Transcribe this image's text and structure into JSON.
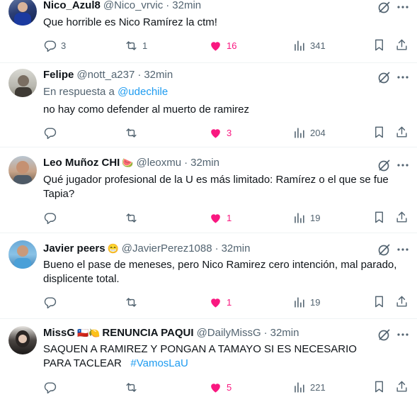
{
  "tweets": [
    {
      "name": "Nico_Azul8",
      "name_emoji": "",
      "handle": "@Nico_vrvic",
      "time": "32min",
      "reply_prefix": "",
      "reply_to": "",
      "text": "Que horrible es Nico Ramírez la ctm!",
      "hashtag": "",
      "replies": "3",
      "retweets": "1",
      "likes": "16",
      "views": "341",
      "liked": true
    },
    {
      "name": "Felipe",
      "name_emoji": "",
      "handle": "@nott_a237",
      "time": "32min",
      "reply_prefix": "En respuesta a",
      "reply_to": "@udechile",
      "text": "no hay como defender al muerto de ramirez",
      "hashtag": "",
      "replies": "",
      "retweets": "",
      "likes": "3",
      "views": "204",
      "liked": true
    },
    {
      "name": "Leo Muñoz CHI",
      "name_emoji": "🍉",
      "handle": "@leoxmu",
      "time": "32min",
      "reply_prefix": "",
      "reply_to": "",
      "text": "Qué jugador profesional de la U es más limitado: Ramírez o el que se fue Tapia?",
      "hashtag": "",
      "replies": "",
      "retweets": "",
      "likes": "1",
      "views": "19",
      "liked": true
    },
    {
      "name": "Javier peers",
      "name_emoji": "😁",
      "handle": "@JavierPerez1088",
      "time": "32min",
      "reply_prefix": "",
      "reply_to": "",
      "text": "Bueno el pase de meneses, pero Nico Ramirez cero intención, mal parado, displicente total.",
      "hashtag": "",
      "replies": "",
      "retweets": "",
      "likes": "1",
      "views": "19",
      "liked": true
    },
    {
      "name": "MissG",
      "name_emoji": "🇨🇱🍋",
      "name_suffix": "RENUNCIA PAQUI",
      "handle": "@DailyMissG",
      "time": "32min",
      "reply_prefix": "",
      "reply_to": "",
      "text": "SAQUEN A RAMIREZ Y PONGAN A TAMAYO SI ES NECESARIO PARA TACLEAR",
      "hashtag": "#VamosLaU",
      "replies": "",
      "retweets": "",
      "likes": "5",
      "views": "221",
      "liked": true
    }
  ],
  "colors": {
    "like": "#f91880",
    "link": "#1d9bf0",
    "muted": "#536471"
  },
  "icons": [
    "reply-icon",
    "retweet-icon",
    "heart-icon",
    "views-icon",
    "bookmark-icon",
    "share-icon",
    "grok-icon",
    "more-icon"
  ]
}
